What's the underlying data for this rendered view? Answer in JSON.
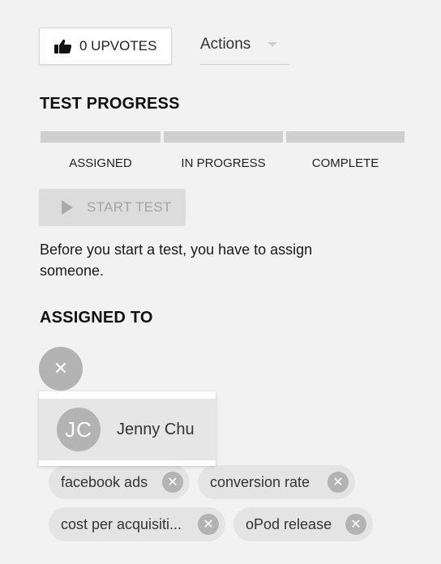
{
  "upvote": {
    "count_label": "0 UPVOTES",
    "icon": "thumbs-up-icon"
  },
  "actions": {
    "label": "Actions"
  },
  "progress": {
    "title": "TEST PROGRESS",
    "steps": [
      "ASSIGNED",
      "IN PROGRESS",
      "COMPLETE"
    ]
  },
  "start_test": {
    "label": "START TEST",
    "icon": "play-icon"
  },
  "hint": "Before you start a test, you have to assign someone.",
  "assigned": {
    "title": "ASSIGNED TO",
    "remove_symbol": "✕",
    "dropdown": [
      {
        "initials": "JC",
        "name": "Jenny Chu"
      }
    ]
  },
  "tags": [
    {
      "label": "facebook ads",
      "remove_symbol": "✕"
    },
    {
      "label": "conversion rate",
      "remove_symbol": "✕"
    },
    {
      "label": "cost per acquisiti...",
      "remove_symbol": "✕"
    },
    {
      "label": "oPod release",
      "remove_symbol": "✕"
    }
  ],
  "colors": {
    "background": "#f2f2f2",
    "progress_track": "#cfcfcf",
    "disabled_button": "#dcdcdc",
    "avatar": "#b3b3b3",
    "tag": "#e4e4e4"
  }
}
